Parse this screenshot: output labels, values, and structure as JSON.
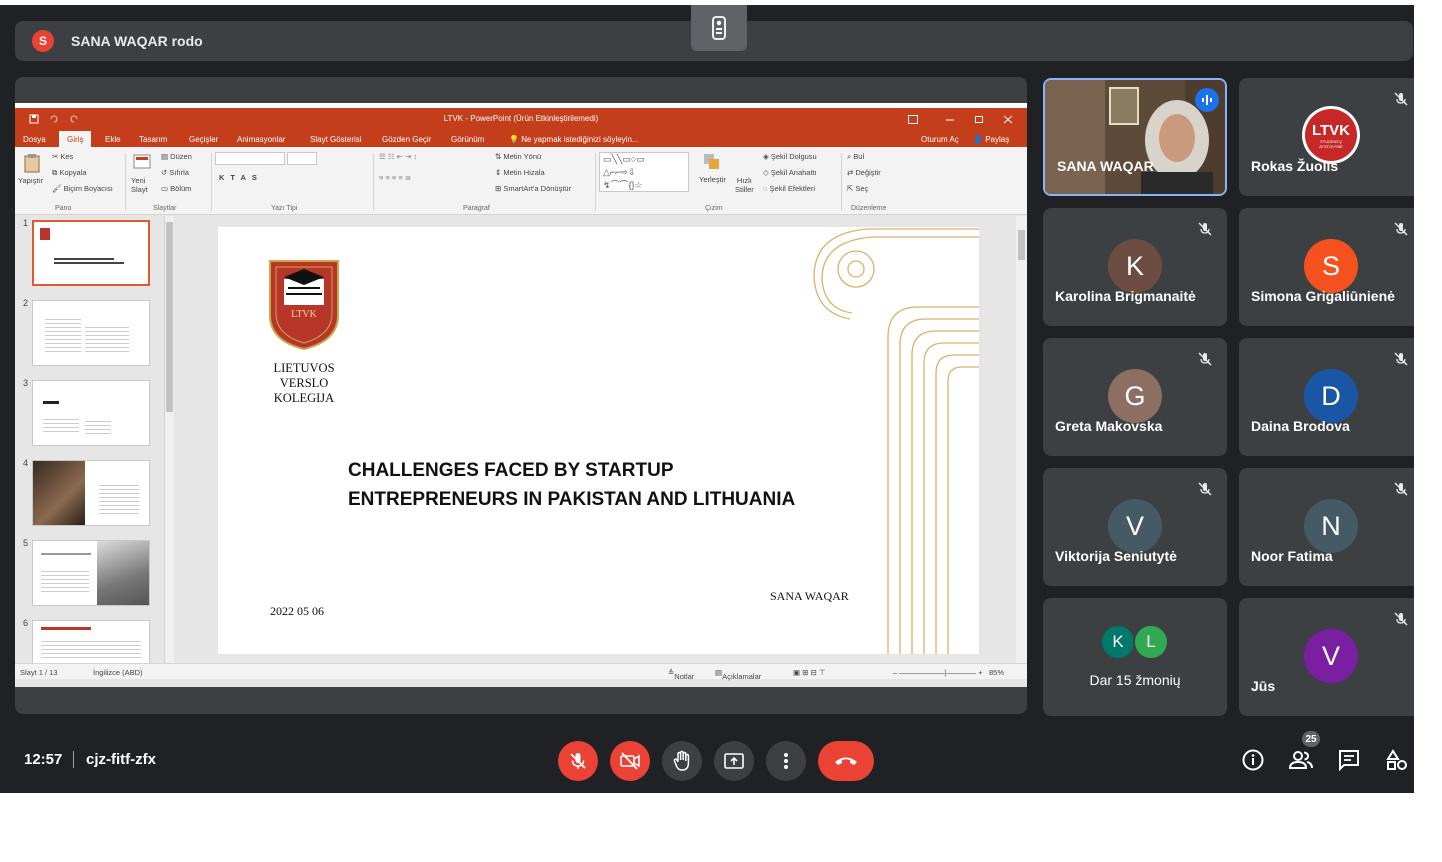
{
  "presenter": {
    "avatar_letter": "S",
    "name": "SANA WAQAR rodo"
  },
  "powerpoint": {
    "window_title": "LTVK - PowerPoint (Ürün Etkinleştirilemedi)",
    "tabs": [
      "Dosya",
      "Giriş",
      "Ekle",
      "Tasarım",
      "Geçişler",
      "Animasyonlar",
      "Slayt Gösterisi",
      "Gözden Geçir",
      "Görünüm"
    ],
    "tell_me": "Ne yapmak istediğinizi söyleyin...",
    "sign_in": "Oturum Aç",
    "share": "Paylaş",
    "ribbon": {
      "clipboard": {
        "paste": "Yapıştır",
        "cut": "Kes",
        "copy": "Kopyala",
        "format_painter": "Biçim Boyacısı",
        "group": "Pano"
      },
      "slides": {
        "new_slide": "Yeni\nSlayt",
        "layout": "Düzen",
        "reset": "Sıfırla",
        "section": "Bölüm",
        "group": "Slaytlar"
      },
      "font_group": "Yazı Tipi",
      "paragraph": {
        "text_direction": "Metin Yönü",
        "align_text": "Metin Hizala",
        "smartart": "SmartArt'a Dönüştür",
        "group": "Paragraf"
      },
      "drawing": {
        "arrange": "Yerleştir",
        "quick_styles": "Hızlı\nStiller",
        "shape_fill": "Şekil Dolgusu",
        "shape_outline": "Şekil Anahattı",
        "shape_effects": "Şekil Efektleri",
        "group": "Çizim"
      },
      "editing": {
        "find": "Bul",
        "replace": "Değiştir",
        "select": "Seç",
        "group": "Düzenleme"
      }
    },
    "thumbnail_numbers": [
      "1",
      "2",
      "3",
      "4",
      "5",
      "6"
    ],
    "slide": {
      "logo_abbr": "LTVK",
      "logo_lines": [
        "LIETUVOS",
        "VERSLO",
        "KOLEGIJA"
      ],
      "title_line1": "CHALLENGES FACED BY STARTUP",
      "title_line2": "ENTREPRENEURS IN PAKISTAN AND LITHUANIA",
      "date": "2022 05 06",
      "author": "SANA WAQAR"
    },
    "status": {
      "slide_count": "Slayt 1 / 13",
      "language": "İngilizce (ABD)",
      "notes": "Notlar",
      "comments": "Açıklamalar",
      "zoom": "85%"
    }
  },
  "participants": [
    {
      "name": "SANA WAQAR",
      "type": "video",
      "speaking": true
    },
    {
      "name": "Rokas Žuolis",
      "type": "logo",
      "logo_text": "LTVK",
      "logo_sub": "STUDENTŲ ATSTOVYBĖ",
      "muted": true
    },
    {
      "name": "Karolina Brigmanaitė",
      "letter": "K",
      "color": "#6d4c41",
      "muted": true
    },
    {
      "name": "Simona Grigaliūnienė",
      "letter": "S",
      "color": "#f4511e",
      "muted": true
    },
    {
      "name": "Greta Makovska",
      "letter": "G",
      "color": "#8d6e63",
      "muted": true
    },
    {
      "name": "Daina Brodova",
      "letter": "D",
      "color": "#1a56a6",
      "muted": true
    },
    {
      "name": "Viktorija Seniutytė",
      "letter": "V",
      "color": "#455a64",
      "muted": true
    },
    {
      "name": "Noor Fatima",
      "letter": "N",
      "color": "#455a64",
      "muted": true
    },
    {
      "name": "Dar 15 žmonių",
      "type": "more",
      "letters": [
        "K",
        "L"
      ],
      "colors": [
        "#00796b",
        "#33a852"
      ]
    },
    {
      "name": "Jūs",
      "letter": "V",
      "color": "#7b1fa2",
      "muted": true
    }
  ],
  "controls": {
    "time": "12:57",
    "meeting_code": "cjz-fitf-zfx",
    "people_count": "25"
  }
}
